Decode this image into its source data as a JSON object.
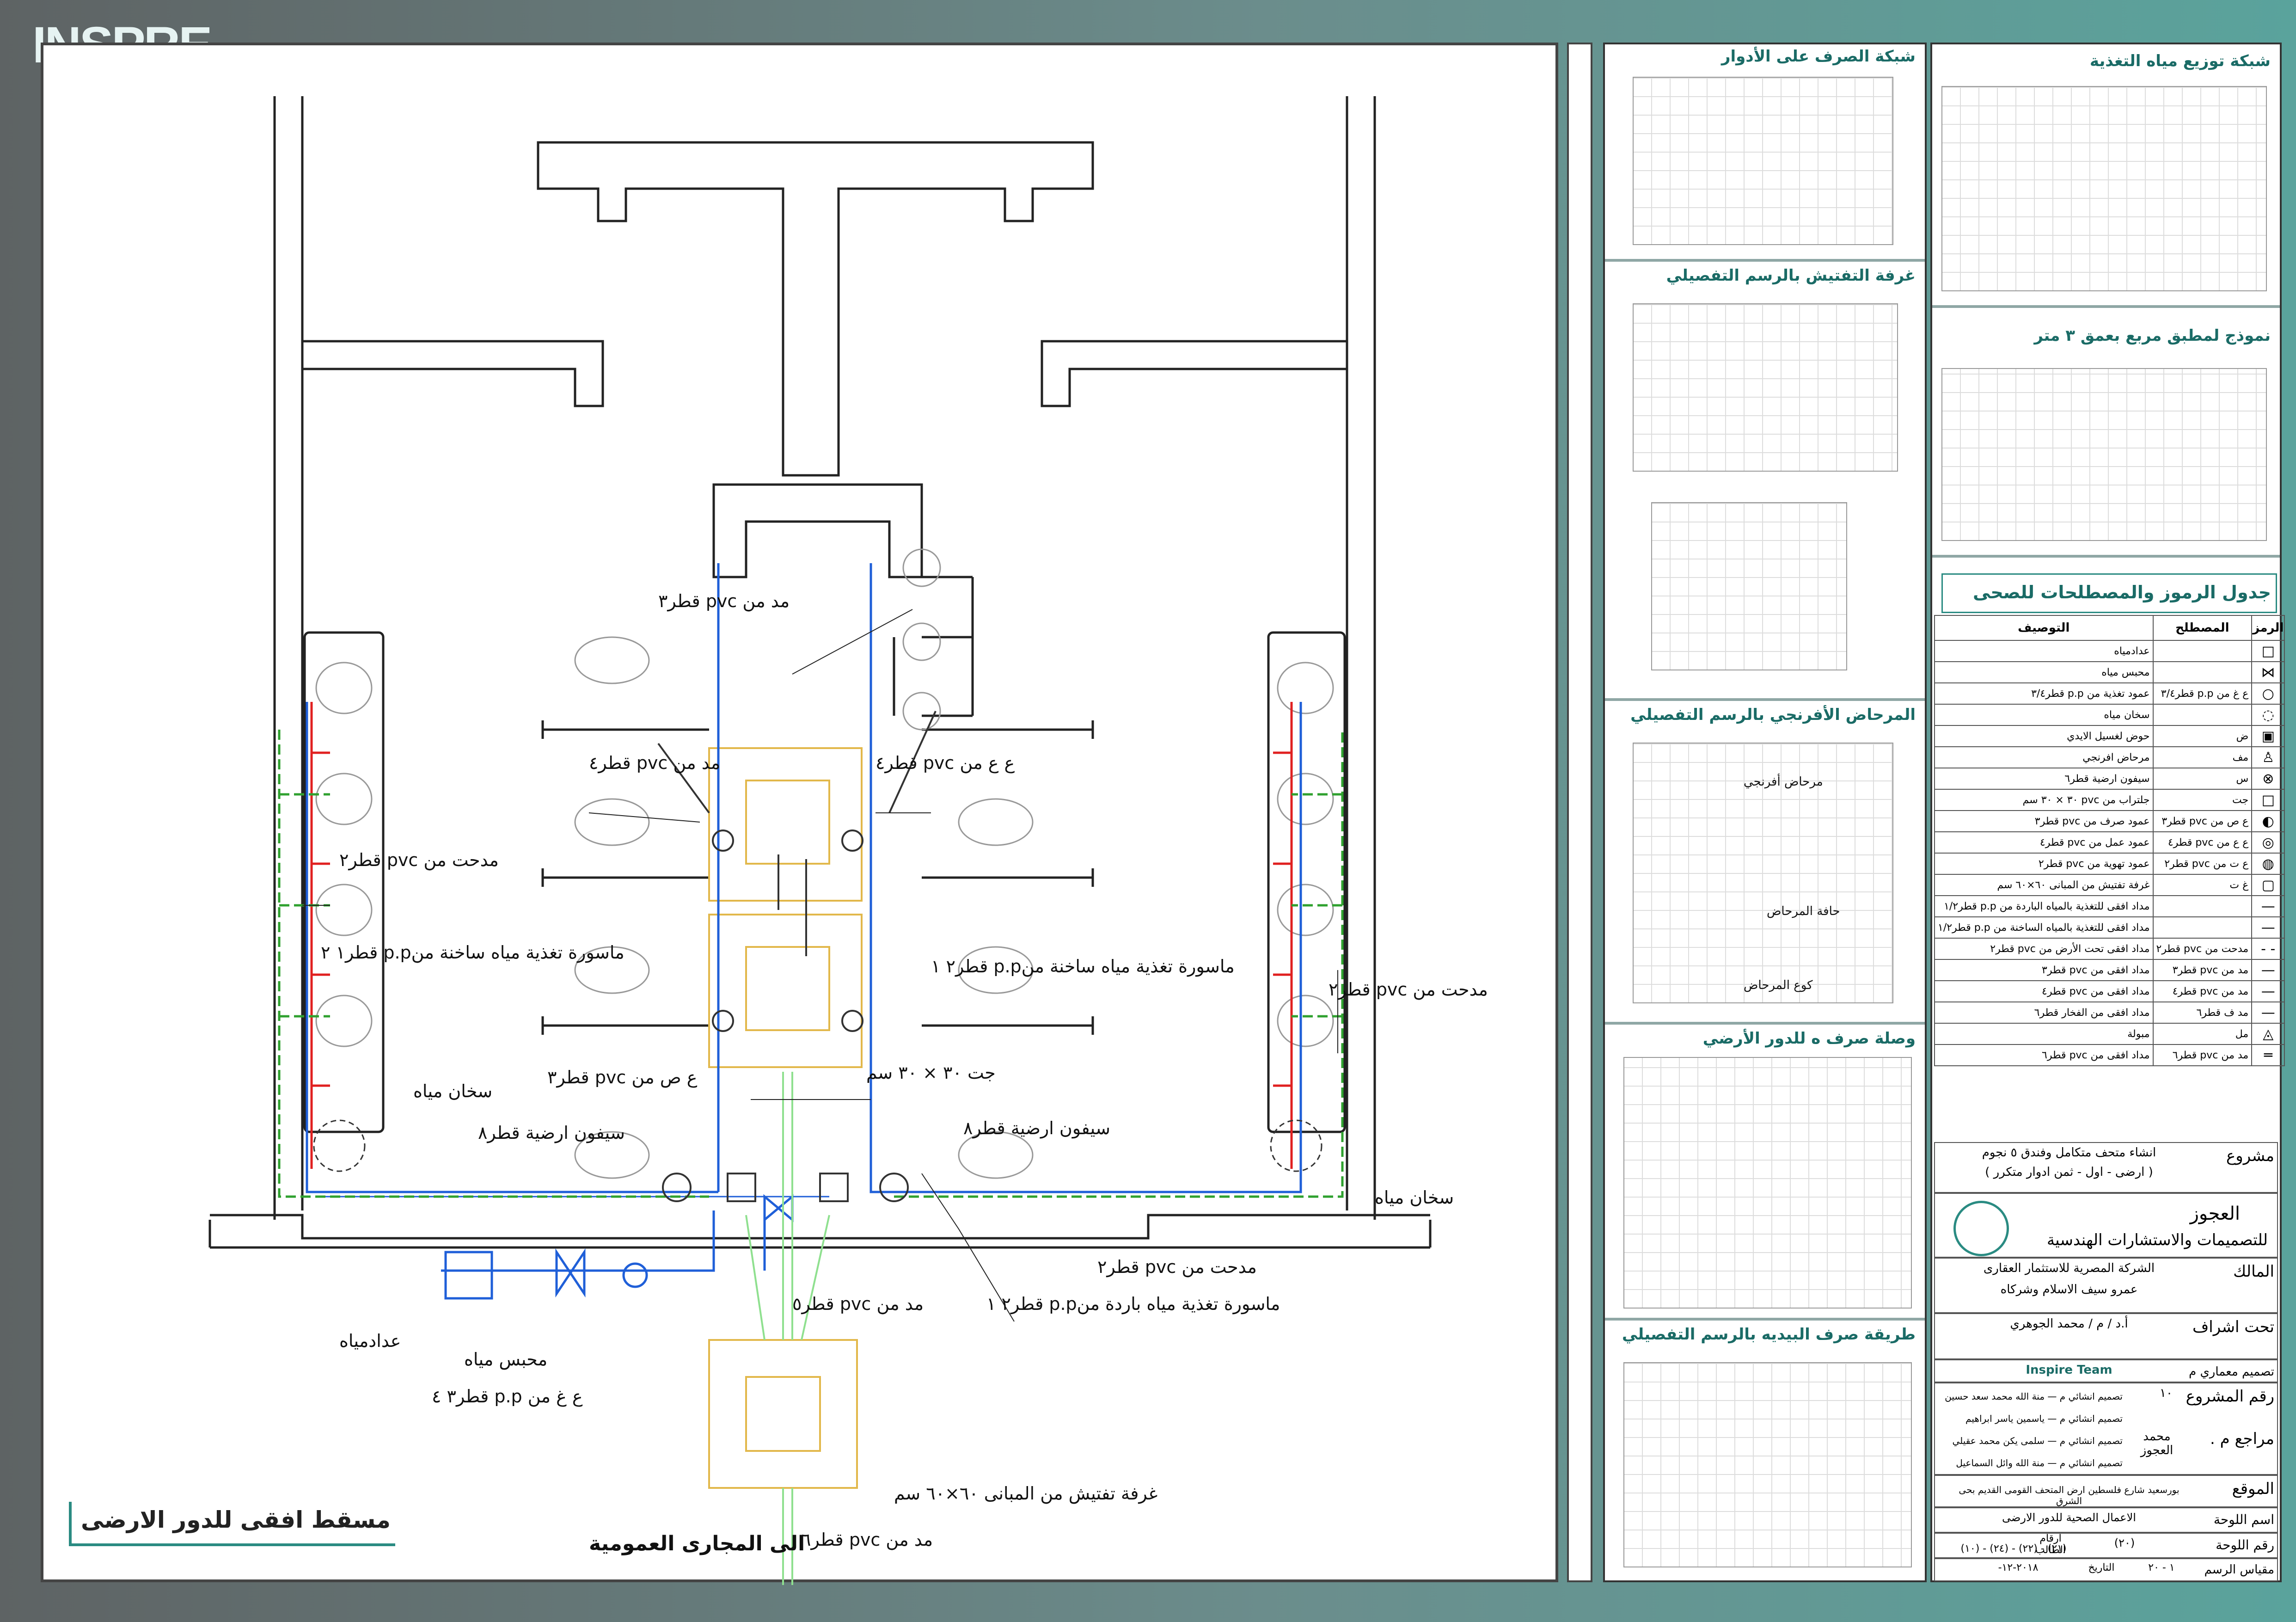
{
  "brand": {
    "logo": "INSPRE"
  },
  "drawing": {
    "title": "مسقط افقى للدور الارضى",
    "outlet_label": "الى المجارى العمومية",
    "labels": [
      "مد من pvc قطر٣",
      "مد من pvc قطر٤",
      "ع ع من pvc قطر٤",
      "مدحت من pvc قطر٢",
      "ماسورة تغذية مياه ساخنة منp.p قطر١ ٢",
      "ماسورة تغذية مياه ساخنة منp.p قطر٢ ١",
      "مدحت من pvc قطر٢",
      "ع ص من pvc قطر٣",
      "جت ٣٠ × ٣٠ سم",
      "سخان مياه",
      "سيفون ارضية قطر٨",
      "سيفون ارضية قطر٨",
      "سخان مياه",
      "مدحت من pvc قطر٢",
      "ماسورة تغذية مياه باردة منp.p قطر٢ ١",
      "مد من pvc قطر٥",
      "عدادمياه",
      "محبس مياه",
      "ع غ من p.p قطر٣ ٤",
      "غرفة تفتيش من المبانى ٦٠×٦٠ سم",
      "مد من pvc قطر٦"
    ]
  },
  "panels": {
    "left": [
      {
        "title": "شبكة الصرف على الأدوار"
      },
      {
        "title": "غرفة التفتيش بالرسم التفصيلي"
      },
      {
        "title": "المرحاض الأفرنجي بالرسم التفصيلي",
        "callouts": [
          "مرحاض أفرنجي",
          "حافة المرحاض",
          "كوع المرحاض"
        ]
      },
      {
        "title": "وصلة صرف ه للدور الأرضي"
      },
      {
        "title": "طريقة صرف البيديه بالرسم التفصيلي"
      }
    ],
    "right": [
      {
        "title": "شبكة توزيع مياه التغذية"
      },
      {
        "title": "نموذج لمطبق مربع بعمق ٣ متر"
      }
    ]
  },
  "legend": {
    "title": "جدول الرموز والمصطلحات للصحى",
    "headers": [
      "الرمز",
      "المصطلح",
      "التوصيف"
    ],
    "rows": [
      {
        "sym": "□",
        "term": "",
        "desc": "عدادمياه"
      },
      {
        "sym": "⋈",
        "term": "",
        "desc": "محبس مياه"
      },
      {
        "sym": "○",
        "term": "ع غ من p.p قطر٣/٤",
        "desc": "عمود تغذية من p.p قطر٣/٤"
      },
      {
        "sym": "◌",
        "term": "",
        "desc": "سخان مياه"
      },
      {
        "sym": "▣",
        "term": "ض",
        "desc": "حوض لغسيل الايدي"
      },
      {
        "sym": "♙",
        "term": "مف",
        "desc": "مرحاض افرنجي"
      },
      {
        "sym": "⊗",
        "term": "س",
        "desc": "سيفون ارضية قطر٦"
      },
      {
        "sym": "□",
        "term": "جت",
        "desc": "جلتراب من pvc ٣٠ × ٣٠ سم"
      },
      {
        "sym": "◐",
        "term": "ع ص من pvc قطر٣",
        "desc": "عمود صرف من pvc قطر٣"
      },
      {
        "sym": "◎",
        "term": "ع ع من pvc قطر٤",
        "desc": "عمود عمل من pvc قطر٤"
      },
      {
        "sym": "◍",
        "term": "ع ت من pvc قطر٢",
        "desc": "عمود تهوية من pvc قطر٢"
      },
      {
        "sym": "▢",
        "term": "غ ت",
        "desc": "غرفة تفتيش من المبانى ٦٠×٦٠ سم"
      },
      {
        "sym": "—",
        "term": "",
        "desc": "مداد افقى للتغذية بالمياه الباردة من p.p قطر١/٢"
      },
      {
        "sym": "—",
        "term": "",
        "desc": "مداد افقى للتغذية بالمياه الساخنة من p.p قطر١/٢"
      },
      {
        "sym": "- -",
        "term": "مدحت من pvc قطر٢",
        "desc": "مداد افقى تحت الأرض من pvc قطر٢"
      },
      {
        "sym": "—",
        "term": "مد من pvc قطر٣",
        "desc": "مداد افقى من pvc قطر٣"
      },
      {
        "sym": "—",
        "term": "مد من pvc قطر٤",
        "desc": "مداد افقى من pvc قطر٤"
      },
      {
        "sym": "—",
        "term": "مد ف قطر٦",
        "desc": "مداد افقى من الفخار قطر٦"
      },
      {
        "sym": "◬",
        "term": "مل",
        "desc": "مبولة"
      },
      {
        "sym": "═",
        "term": "مد من pvc قطر٦",
        "desc": "مداد افقى من pvc قطر٦"
      }
    ],
    "colors": {
      "cold": "#1f5fd8",
      "hot": "#e02020",
      "green": "#2fa12f",
      "lightgreen": "#8fe08f"
    }
  },
  "titleblock": {
    "project_label": "مشروع",
    "project_value": "انشاء متحف متكامل وفندق ٥ نجوم",
    "project_sub": "( ارضى - اول - ثمن ادوار متكرر )",
    "office_name": "العجوز",
    "office_sub": "للتصميمات والاستشارات الهندسية",
    "owner_label": "المالك",
    "owner_value": "الشركة المصرية للاستثمار العقارى",
    "owner_sub": "عمرو سيف الاسلام وشركاه",
    "supervision_label": "تحت اشراف",
    "supervision_value": "أ.د / م / محمد الجوهري",
    "team": "Inspire Team",
    "arch_design_label": "تصميم معماري م",
    "designers": [
      "تصميم انشائي م",
      "تصميم انشائي م",
      "تصميم انشائي م",
      "تصميم انشائي م"
    ],
    "names": [
      "منة الله محمد سعد حسين",
      "ياسمين ياسر ابراهيم",
      "سلمى يكن محمد عقيلي",
      "منة الله وائل السماعيل"
    ],
    "number_label": "رقم المشروع",
    "number_value": "١٠",
    "reviewer_label": "مراجع م .",
    "reviewer_value": "محمد العجوز",
    "location_label": "الموقع",
    "location_value": "بورسعيد شارع فلسطين ارض المتحف القومى القديم بحى الشرق",
    "sheet_name_label": "اسم اللوحة",
    "sheet_name_value": "الاعمال الصحية للدور الارضى",
    "sheet_no_label": "رقم اللوحة",
    "sheet_no_value": "(٢٠)",
    "student_no_label": "ارقام الطالب",
    "student_no_value": "(٢١) - (٢٢) - (٢٤) - (١٠)",
    "scale_label": "مقياس الرسم",
    "scale_value": "١ - ٢٠",
    "date_label": "التاريخ",
    "date_value": "٢٠١٨-١٢-"
  }
}
